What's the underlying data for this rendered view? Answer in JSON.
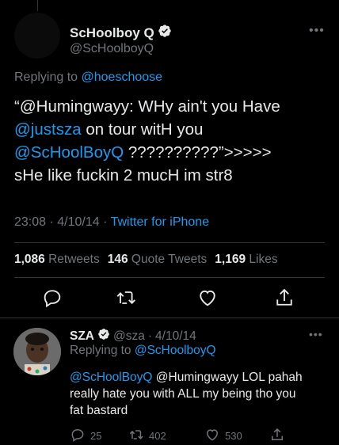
{
  "main_tweet": {
    "display_name": "ScHoolboy Q",
    "handle": "@ScHoolboyQ",
    "replying_prefix": "Replying to ",
    "replying_to": "@hoeschoose",
    "text_line1": "“@Humingwayy: WHy ain't you Have",
    "text_line2_mention": "@justsza",
    "text_line2_rest": " on tour witH you",
    "text_line3_mention": "@ScHoolBoyQ",
    "text_line3_rest": " ??????????”>>>>>",
    "text_line4": "sHe like fuckin 2 mucH im str8",
    "time": "23:08",
    "date": "4/10/14",
    "source": "Twitter for iPhone",
    "retweets_count": "1,086",
    "retweets_label": "Retweets",
    "quotes_count": "146",
    "quotes_label": "Quote Tweets",
    "likes_count": "1,169",
    "likes_label": "Likes"
  },
  "reply_tweet": {
    "display_name": "SZA",
    "handle": "@sza",
    "date": "4/10/14",
    "replying_prefix": "Replying to ",
    "replying_to": "@ScHoolboyQ",
    "text_mention": "@ScHoolBoyQ",
    "text_rest1": " @Humingwayy LOL pahah",
    "text_line2": "really hate you with ALL my being tho you",
    "text_line3": "fat bastard",
    "replies": "25",
    "retweets": "402",
    "likes": "530"
  },
  "icons": {
    "verified": "verified-badge-icon",
    "more": "more-icon",
    "reply": "reply-icon",
    "retweet": "retweet-icon",
    "like": "heart-icon",
    "share": "share-icon"
  },
  "colors": {
    "accent": "#1d9bf0",
    "muted": "#71767b",
    "background": "#000000"
  }
}
